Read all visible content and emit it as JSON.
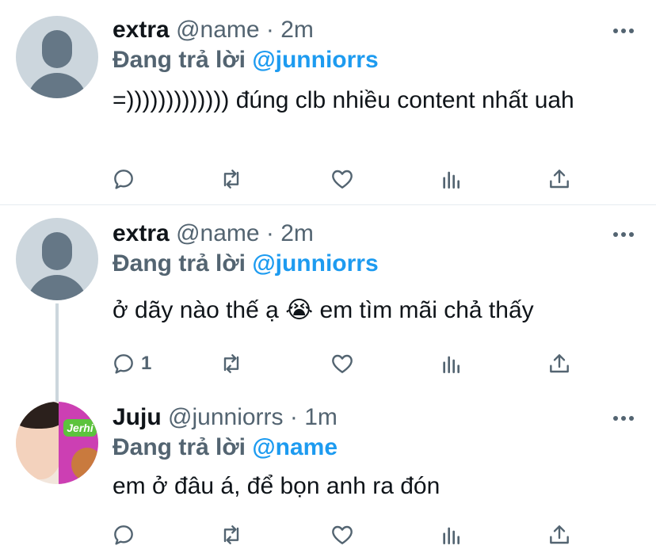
{
  "tweets": [
    {
      "name": "extra",
      "handle": "@name",
      "time": "· 2m",
      "reply_prefix": "Đang trả lời",
      "reply_to": "@junniorrs",
      "text": "=))))))))))))) đúng clb nhiều content nhất uah",
      "reply_count": "",
      "avatar": "default-avatar"
    },
    {
      "name": "extra",
      "handle": "@name",
      "time": "· 2m",
      "reply_prefix": "Đang trả lời",
      "reply_to": "@junniorrs",
      "text": "ở dãy nào thế ạ 😭  em tìm mãi chả thấy",
      "reply_count": "1",
      "avatar": "default-avatar"
    },
    {
      "name": "Juju",
      "handle": "@junniorrs",
      "time": "· 1m",
      "reply_prefix": "Đang trả lời",
      "reply_to": "@name",
      "text": "em ở đâu á, để bọn anh ra đón",
      "reply_count": "",
      "avatar": "photo-avatar",
      "avatar_pack_text": "Jerhi"
    }
  ],
  "icons": {
    "reply": "reply-icon",
    "retweet": "retweet-icon",
    "like": "heart-icon",
    "analytics": "analytics-icon",
    "share": "share-icon",
    "more": "more-icon"
  },
  "colors": {
    "mention": "#1d9bf0",
    "muted": "#536471",
    "text": "#0f1419"
  }
}
